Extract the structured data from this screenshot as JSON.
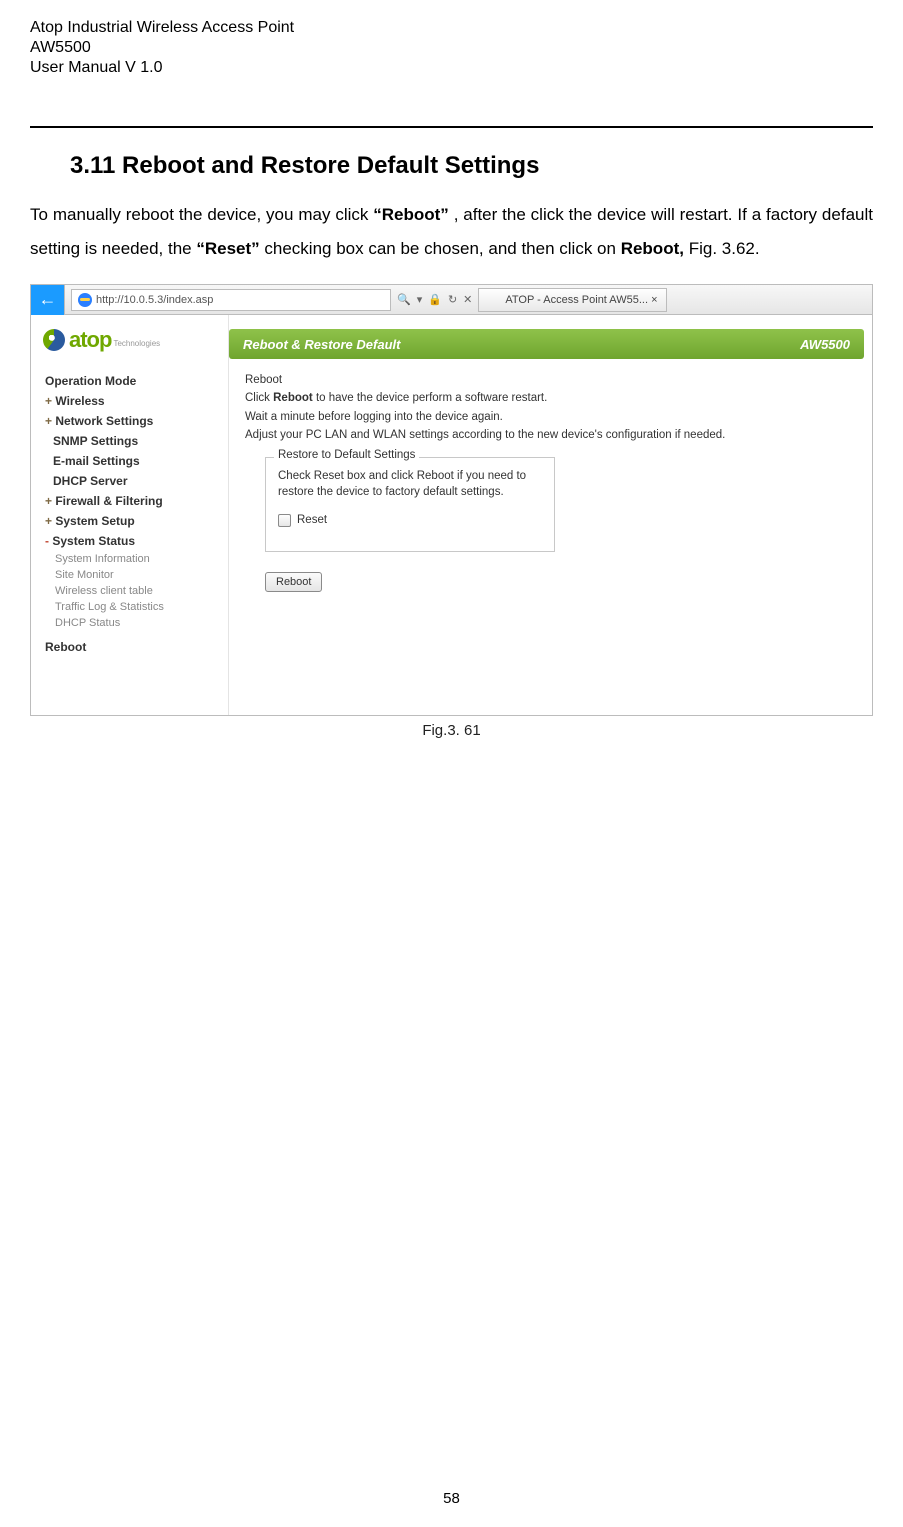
{
  "doc_header": {
    "line1": "Atop Industrial Wireless Access Point",
    "line2": "AW5500",
    "line3": "User Manual V 1.0"
  },
  "section": {
    "number_title": "3.11 Reboot and Restore Default Settings"
  },
  "paragraph": {
    "p1a": "To manually reboot the device, you may click ",
    "p1b": "“Reboot”",
    "p1c": ", after the click the device will restart. If a factory default setting is needed, the ",
    "p1d": "“Reset”",
    "p1e": " checking box can be chosen, and then click on ",
    "p1f": "Reboot,",
    "p1g": " Fig. 3.62."
  },
  "chrome": {
    "url": "http://10.0.5.3/index.asp",
    "search_icons": "⍟ ▾ 🔒 ↻ ✕",
    "tab_title": "ATOP - Access Point AW55...  ×"
  },
  "logo": {
    "brand": "atop",
    "sub": "Technologies"
  },
  "nav": {
    "op_mode": "Operation Mode",
    "wireless": "Wireless",
    "net": "Network Settings",
    "snmp": "SNMP Settings",
    "email": "E-mail Settings",
    "dhcp": "DHCP Server",
    "fw": "Firewall & Filtering",
    "sys_setup": "System Setup",
    "sys_status": "System Status",
    "subs": {
      "sysinfo": "System Information",
      "site": "Site Monitor",
      "wct": "Wireless client table",
      "traffic": "Traffic Log & Statistics",
      "dhcps": "DHCP Status"
    },
    "reboot": "Reboot"
  },
  "panel": {
    "title_left": "Reboot & Restore Default",
    "title_right": "AW5500",
    "heading": "Reboot",
    "line1a": "Click ",
    "line1b": "Reboot",
    "line1c": " to have the device perform a software restart.",
    "line2": "Wait a minute before logging into the device again.",
    "line3": "Adjust your PC LAN and WLAN settings according to the new device's configuration if needed.",
    "legend": "Restore to Default Settings",
    "fs_line1a": "Check ",
    "fs_line1b": "Reset",
    "fs_line1c": " box and click ",
    "fs_line1d": "Reboot",
    "fs_line1e": " if you need to restore the device to factory default settings.",
    "checkbox_label": "Reset",
    "button_label": "Reboot"
  },
  "figure_caption": "Fig.3. 61",
  "page_number": "58"
}
